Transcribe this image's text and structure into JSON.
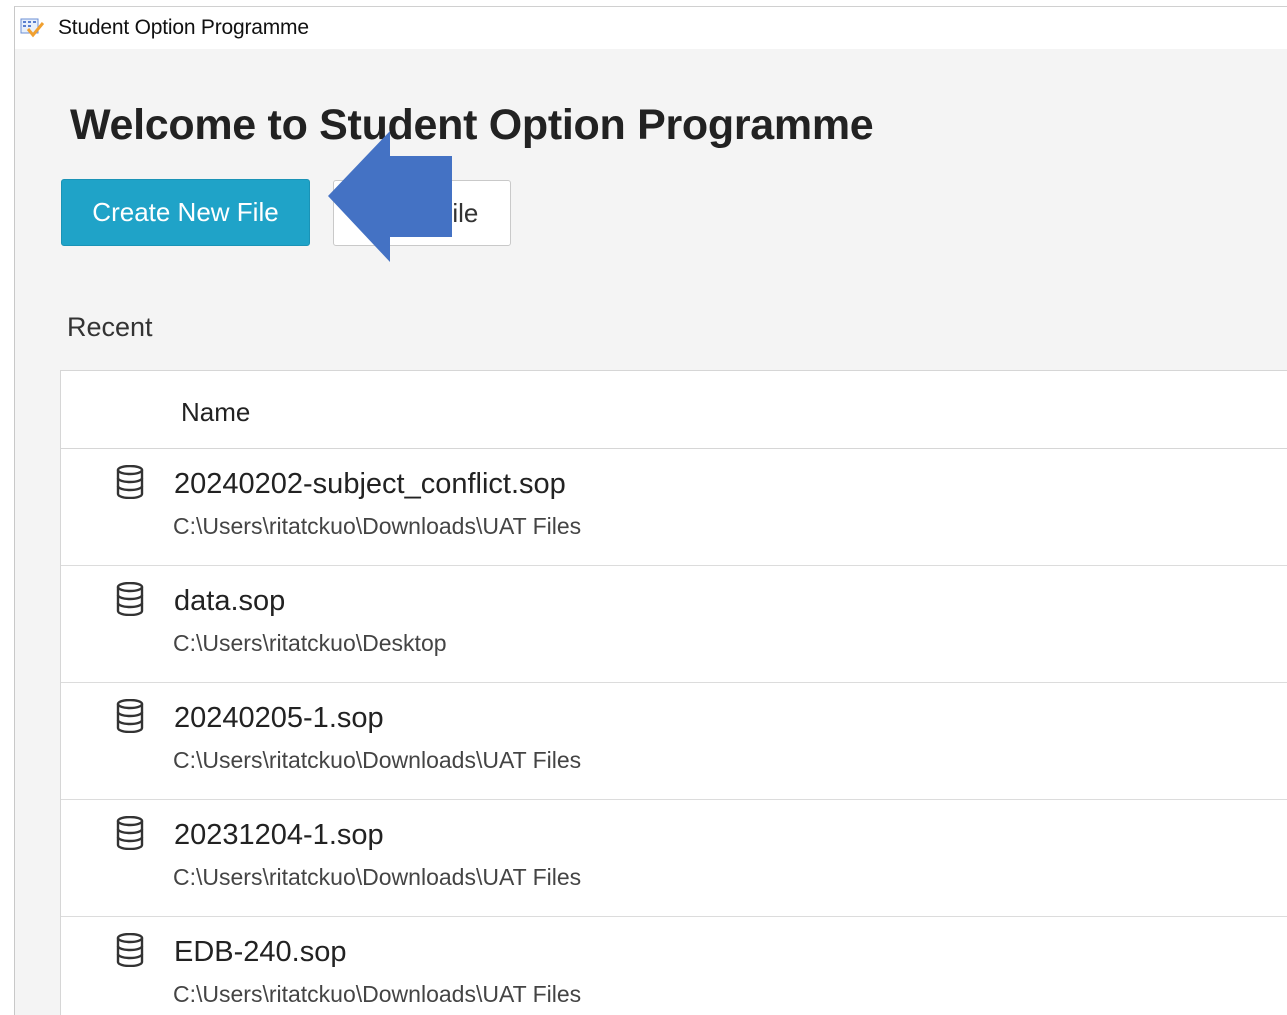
{
  "window": {
    "title": "Student Option Programme",
    "app_icon": "calendar-check-icon"
  },
  "welcome": {
    "heading": "Welcome to Student Option Programme",
    "create_label": "Create New File",
    "open_label": "Open File"
  },
  "annotation": {
    "arrow_color": "#4472c4",
    "arrow_direction": "left"
  },
  "recent": {
    "heading": "Recent",
    "column_name": "Name",
    "item_icon": "database-icon",
    "files": [
      {
        "name": "20240202-subject_conflict.sop",
        "path": "C:\\Users\\ritatckuo\\Downloads\\UAT Files"
      },
      {
        "name": "data.sop",
        "path": "C:\\Users\\ritatckuo\\Desktop"
      },
      {
        "name": "20240205-1.sop",
        "path": "C:\\Users\\ritatckuo\\Downloads\\UAT Files"
      },
      {
        "name": "20231204-1.sop",
        "path": "C:\\Users\\ritatckuo\\Downloads\\UAT Files"
      },
      {
        "name": "EDB-240.sop",
        "path": "C:\\Users\\ritatckuo\\Downloads\\UAT Files"
      }
    ]
  },
  "colors": {
    "primary_button": "#1fa3c8",
    "background": "#f4f4f4"
  }
}
